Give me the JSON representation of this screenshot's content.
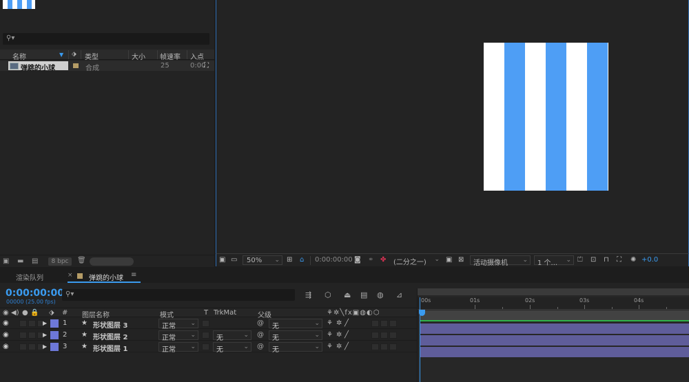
{
  "project": {
    "columns": {
      "name": "名称",
      "type": "类型",
      "size": "大小",
      "framerate": "帧速率",
      "in_point": "入点"
    },
    "items": [
      {
        "name": "弹跳的小球",
        "type": "合成",
        "framerate": "25",
        "in_point": "0:00"
      }
    ],
    "bit_depth": "8 bpc"
  },
  "viewer": {
    "zoom": "50%",
    "timecode": "0:00:00:00",
    "resolution": "(二分之一)",
    "camera": "活动摄像机",
    "views": "1 个...",
    "exposure": "+0.0"
  },
  "tabs": {
    "render_queue": "渲染队列",
    "comp": "弹跳的小球"
  },
  "timeline": {
    "timecode": "0:00:00:00",
    "fps": "00000 (25.00 fps)",
    "columns": {
      "num": "#",
      "layer_name": "图层名称",
      "mode": "模式",
      "t": "T",
      "trkmat": "TrkMat",
      "parent": "父级"
    },
    "layers": [
      {
        "num": "1",
        "name": "形状图层 3",
        "mode": "正常",
        "trkmat": "",
        "parent": "无"
      },
      {
        "num": "2",
        "name": "形状图层 2",
        "mode": "正常",
        "trkmat": "无",
        "parent": "无"
      },
      {
        "num": "3",
        "name": "形状图层 1",
        "mode": "正常",
        "trkmat": "无",
        "parent": "无"
      }
    ],
    "ruler": [
      "00s",
      "01s",
      "02s",
      "03s",
      "04s"
    ]
  },
  "colors": {
    "accent": "#3a9bf0",
    "stripe_blue": "#4e9ef5",
    "layer_label": "#6d78d8",
    "layer_bar": "#5f5d9a",
    "work_area": "#2fb34a"
  }
}
